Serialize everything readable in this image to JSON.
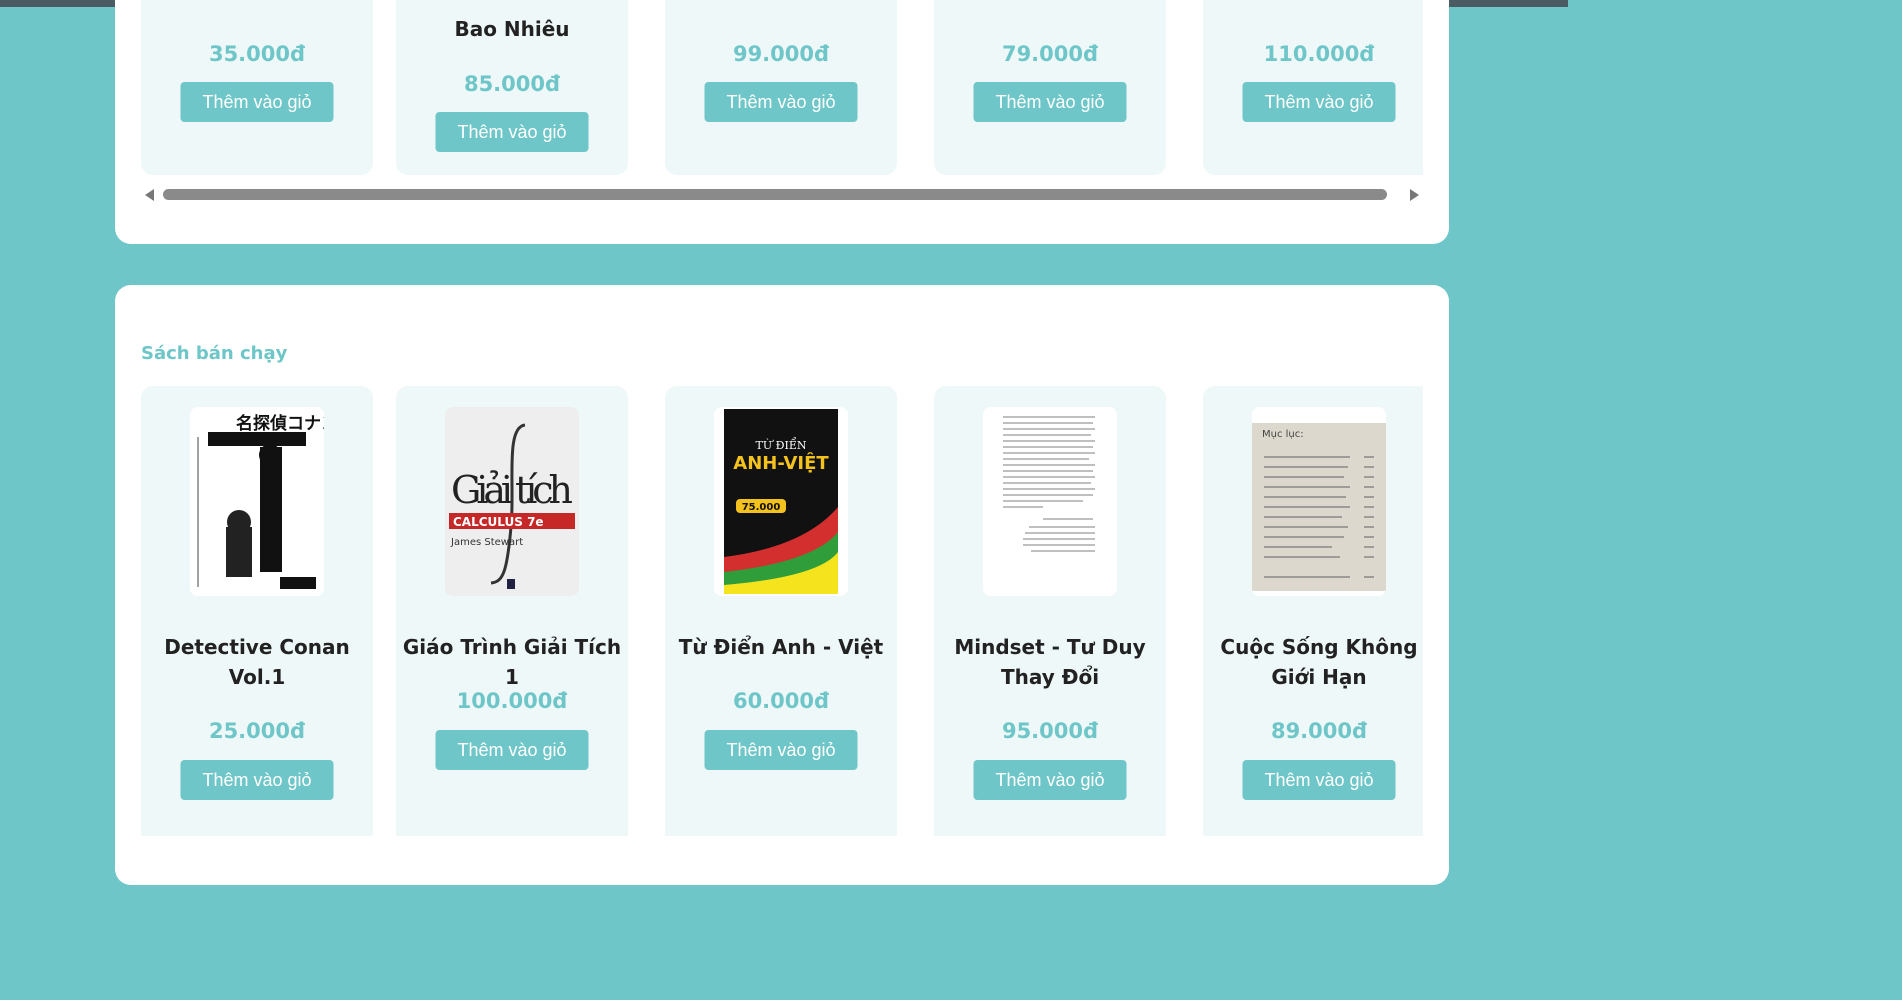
{
  "colors": {
    "accent": "#6ec6c8",
    "card_bg": "#eef8f8",
    "panel_bg": "#ffffff"
  },
  "upper_section": {
    "cards": [
      {
        "title": "",
        "price": "35.000đ",
        "button": "Thêm vào giỏ"
      },
      {
        "title": "Bao Nhiêu",
        "price": "85.000đ",
        "button": "Thêm vào giỏ"
      },
      {
        "title": "",
        "price": "99.000đ",
        "button": "Thêm vào giỏ"
      },
      {
        "title": "",
        "price": "79.000đ",
        "button": "Thêm vào giỏ"
      },
      {
        "title": "",
        "price": "110.000đ",
        "button": "Thêm vào giỏ"
      }
    ]
  },
  "bestsellers": {
    "heading": "Sách bán chạy",
    "cards": [
      {
        "cover_icon": "conan-manga-cover",
        "cover_text": "名探偵コナン",
        "title": "Detective Conan Vol.1",
        "price": "25.000đ",
        "button": "Thêm vào giỏ"
      },
      {
        "cover_icon": "calculus-cover",
        "cover_text": "Giải tích",
        "cover_sub": "CALCULUS 7e",
        "cover_author": "James Stewart",
        "title": "Giáo Trình Giải Tích 1",
        "price": "100.000đ",
        "button": "Thêm vào giỏ"
      },
      {
        "cover_icon": "dictionary-cover",
        "cover_text": "TỪ ĐIỂN",
        "cover_sub": "ANH-VIỆT",
        "cover_badge": "75.000",
        "title": "Từ Điển Anh - Việt",
        "price": "60.000đ",
        "button": "Thêm vào giỏ"
      },
      {
        "cover_icon": "text-page-cover",
        "title": "Mindset - Tư Duy Thay Đổi",
        "price": "95.000đ",
        "button": "Thêm vào giỏ"
      },
      {
        "cover_icon": "table-of-contents-cover",
        "cover_text": "Mục lục:",
        "title": "Cuộc Sống Không Giới Hạn",
        "price": "89.000đ",
        "button": "Thêm vào giỏ"
      }
    ]
  }
}
